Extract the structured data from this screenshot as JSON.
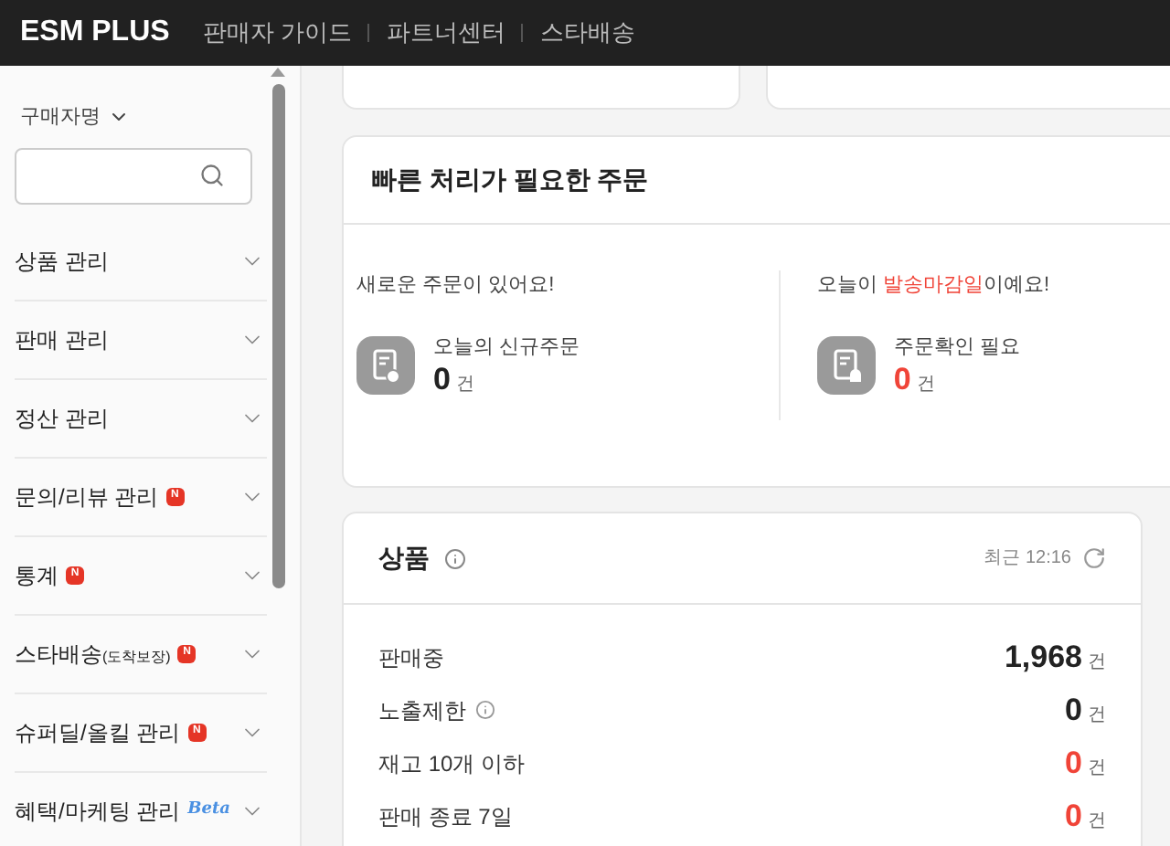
{
  "header": {
    "logo": "ESM PLUS",
    "nav": [
      "판매자 가이드",
      "파트너센터",
      "스타배송"
    ]
  },
  "sidebar": {
    "search_label": "구매자명",
    "menu": [
      {
        "label": "상품 관리"
      },
      {
        "label": "판매 관리"
      },
      {
        "label": "정산 관리"
      },
      {
        "label": "문의/리뷰 관리",
        "badge": {
          "kind": "new",
          "text": "N"
        }
      },
      {
        "label": "통계",
        "badge": {
          "kind": "new",
          "text": "N"
        }
      },
      {
        "label": "스타배송",
        "sub": "(도착보장)",
        "badge": {
          "kind": "new",
          "text": "N"
        }
      },
      {
        "label": "슈퍼딜/올킬 관리",
        "badge": {
          "kind": "new",
          "text": "N"
        }
      },
      {
        "label": "혜택/마케팅 관리",
        "badge": {
          "kind": "beta",
          "text": "Beta"
        }
      }
    ]
  },
  "quick_orders": {
    "title": "빠른 처리가 필요한 주문",
    "panels": [
      {
        "message": [
          {
            "text": "새로운 주문이 있어요!",
            "alert": false
          }
        ],
        "kind": "new",
        "label": "오늘의 신규주문",
        "count": "0",
        "unit": "건",
        "alert": false
      },
      {
        "message": [
          {
            "text": "오늘이 ",
            "alert": false
          },
          {
            "text": "발송마감일",
            "alert": true
          },
          {
            "text": "이예요!",
            "alert": false
          }
        ],
        "kind": "deadline",
        "label": "주문확인 필요",
        "count": "0",
        "unit": "건",
        "alert": true
      }
    ]
  },
  "products": {
    "title": "상품",
    "updated": "최근 12:16",
    "rows": [
      {
        "label": "판매중",
        "info": false,
        "count": "1,968",
        "unit": "건",
        "alert": false
      },
      {
        "label": "노출제한",
        "info": true,
        "count": "0",
        "unit": "건",
        "alert": false
      },
      {
        "label": "재고 10개 이하",
        "info": false,
        "count": "0",
        "unit": "건",
        "alert": true
      },
      {
        "label": "판매 종료 7일",
        "info": false,
        "count": "0",
        "unit": "건",
        "alert": true
      }
    ]
  }
}
